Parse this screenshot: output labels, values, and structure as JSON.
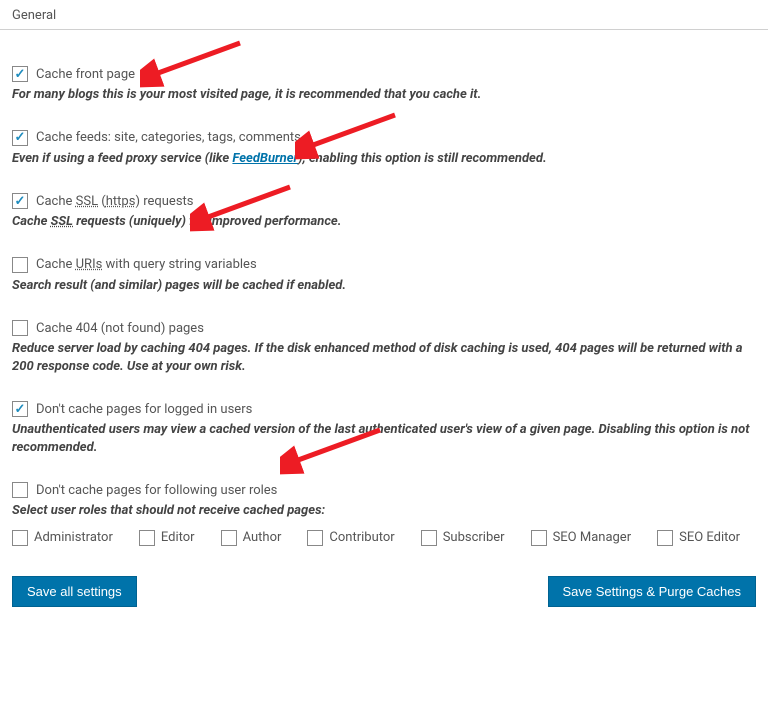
{
  "section_title": "General",
  "options": {
    "cache_front_page": {
      "label": "Cache front page",
      "desc": "For many blogs this is your most visited page, it is recommended that you cache it.",
      "checked": true
    },
    "cache_feeds": {
      "label": "Cache feeds: site, categories, tags, comments",
      "desc_pre": "Even if using a feed proxy service (like ",
      "desc_link": "FeedBurner",
      "desc_post": "), enabling this option is still recommended.",
      "checked": true
    },
    "cache_ssl": {
      "label_pre": "Cache ",
      "label_abbr1": "SSL",
      "label_mid": " (",
      "label_abbr2": "https",
      "label_post": ") requests",
      "desc_pre": "Cache ",
      "desc_abbr": "SSL",
      "desc_post": " requests (uniquely) for improved performance.",
      "checked": true
    },
    "cache_uris_qs": {
      "label_pre": "Cache ",
      "label_abbr": "URIs",
      "label_post": " with query string variables",
      "desc": "Search result (and similar) pages will be cached if enabled.",
      "checked": false
    },
    "cache_404": {
      "label": "Cache 404 (not found) pages",
      "desc": "Reduce server load by caching 404 pages. If the disk enhanced method of disk caching is used, 404 pages will be returned with a 200 response code. Use at your own risk.",
      "checked": false
    },
    "no_cache_logged_in": {
      "label": "Don't cache pages for logged in users",
      "desc": "Unauthenticated users may view a cached version of the last authenticated user's view of a given page. Disabling this option is not recommended.",
      "checked": true
    },
    "no_cache_roles": {
      "label": "Don't cache pages for following user roles",
      "desc": "Select user roles that should not receive cached pages:",
      "checked": false
    }
  },
  "roles": [
    {
      "label": "Administrator"
    },
    {
      "label": "Editor"
    },
    {
      "label": "Author"
    },
    {
      "label": "Contributor"
    },
    {
      "label": "Subscriber"
    },
    {
      "label": "SEO Manager"
    },
    {
      "label": "SEO Editor"
    }
  ],
  "buttons": {
    "save_all": "Save all settings",
    "save_purge": "Save Settings & Purge Caches"
  }
}
